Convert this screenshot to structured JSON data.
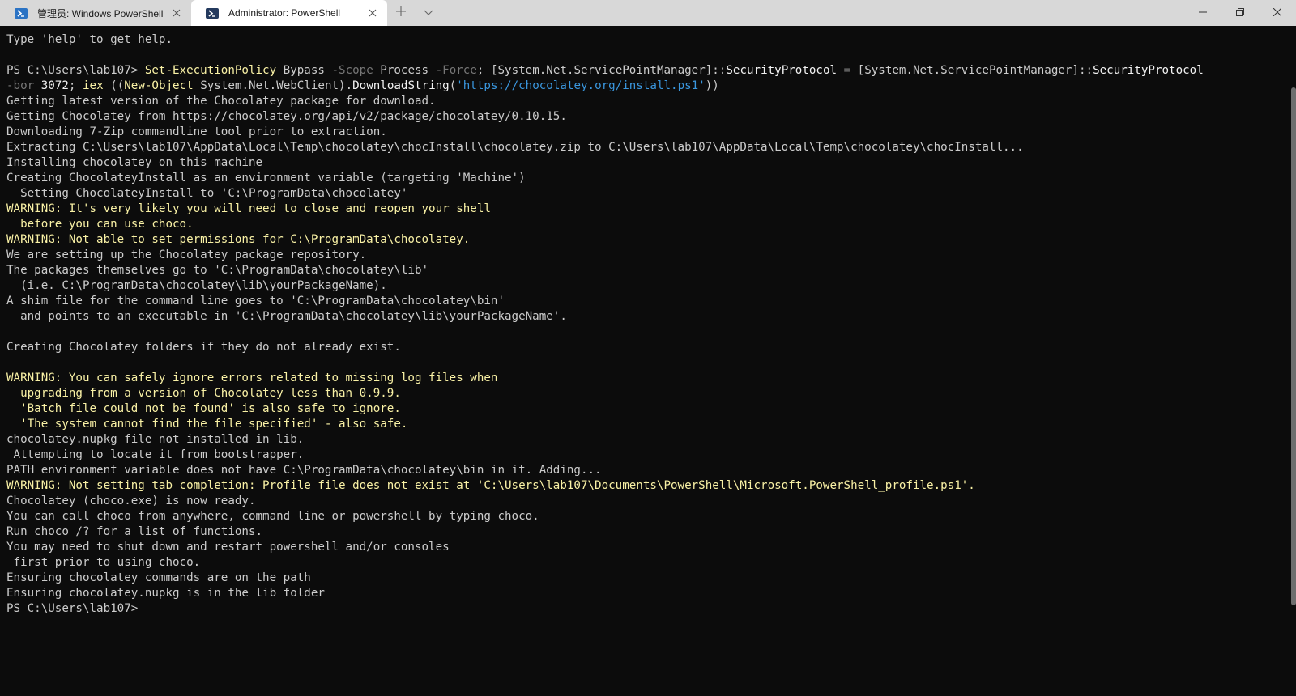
{
  "window": {
    "tabs": [
      {
        "title": "管理员: Windows PowerShell",
        "active": false,
        "icon": "powershell-icon"
      },
      {
        "title": "Administrator: PowerShell",
        "active": true,
        "icon": "powershell-core-icon"
      }
    ],
    "new_tab_icon": "plus-icon",
    "dropdown_icon": "chevron-down-icon",
    "controls": [
      "minimize-icon",
      "restore-icon",
      "close-icon"
    ]
  },
  "colors": {
    "terminal_bg": "#0c0c0c",
    "text": "#cccccc",
    "warning": "#f9f1a5",
    "cmdlet": "#f9f1a5",
    "parameter": "#767676",
    "string": "#3a96dd"
  },
  "terminal": {
    "lines": [
      {
        "type": "normal",
        "text": "Type 'help' to get help."
      },
      {
        "type": "blank",
        "text": ""
      },
      {
        "type": "command",
        "segments": [
          {
            "t": "prompt",
            "text": "PS C:\\Users\\lab107> "
          },
          {
            "t": "cmd",
            "text": "Set-ExecutionPolicy"
          },
          {
            "t": "plain",
            "text": " Bypass "
          },
          {
            "t": "param",
            "text": "-Scope"
          },
          {
            "t": "plain",
            "text": " Process "
          },
          {
            "t": "param",
            "text": "-Force"
          },
          {
            "t": "plain",
            "text": "; [System.Net.ServicePointManager]::"
          },
          {
            "t": "white",
            "text": "SecurityProtocol"
          },
          {
            "t": "param",
            "text": " = "
          },
          {
            "t": "plain",
            "text": "[System.Net.ServicePointManager]::"
          },
          {
            "t": "white",
            "text": "SecurityProtocol"
          }
        ]
      },
      {
        "type": "command",
        "segments": [
          {
            "t": "param",
            "text": "-bor"
          },
          {
            "t": "plain",
            "text": " "
          },
          {
            "t": "num",
            "text": "3072"
          },
          {
            "t": "plain",
            "text": "; "
          },
          {
            "t": "cmd",
            "text": "iex"
          },
          {
            "t": "plain",
            "text": " (("
          },
          {
            "t": "cmd",
            "text": "New-Object"
          },
          {
            "t": "plain",
            "text": " System.Net.WebClient)."
          },
          {
            "t": "white",
            "text": "DownloadString"
          },
          {
            "t": "plain",
            "text": "("
          },
          {
            "t": "str",
            "text": "'https://chocolatey.org/install.ps1'"
          },
          {
            "t": "plain",
            "text": "))"
          }
        ]
      },
      {
        "type": "normal",
        "text": "Getting latest version of the Chocolatey package for download."
      },
      {
        "type": "normal",
        "text": "Getting Chocolatey from https://chocolatey.org/api/v2/package/chocolatey/0.10.15."
      },
      {
        "type": "normal",
        "text": "Downloading 7-Zip commandline tool prior to extraction."
      },
      {
        "type": "normal",
        "text": "Extracting C:\\Users\\lab107\\AppData\\Local\\Temp\\chocolatey\\chocInstall\\chocolatey.zip to C:\\Users\\lab107\\AppData\\Local\\Temp\\chocolatey\\chocInstall..."
      },
      {
        "type": "normal",
        "text": "Installing chocolatey on this machine"
      },
      {
        "type": "normal",
        "text": "Creating ChocolateyInstall as an environment variable (targeting 'Machine')"
      },
      {
        "type": "normal",
        "text": "  Setting ChocolateyInstall to 'C:\\ProgramData\\chocolatey'"
      },
      {
        "type": "warn",
        "text": "WARNING: It's very likely you will need to close and reopen your shell"
      },
      {
        "type": "warn",
        "text": "  before you can use choco."
      },
      {
        "type": "warn",
        "text": "WARNING: Not able to set permissions for C:\\ProgramData\\chocolatey."
      },
      {
        "type": "normal",
        "text": "We are setting up the Chocolatey package repository."
      },
      {
        "type": "normal",
        "text": "The packages themselves go to 'C:\\ProgramData\\chocolatey\\lib'"
      },
      {
        "type": "normal",
        "text": "  (i.e. C:\\ProgramData\\chocolatey\\lib\\yourPackageName)."
      },
      {
        "type": "normal",
        "text": "A shim file for the command line goes to 'C:\\ProgramData\\chocolatey\\bin'"
      },
      {
        "type": "normal",
        "text": "  and points to an executable in 'C:\\ProgramData\\chocolatey\\lib\\yourPackageName'."
      },
      {
        "type": "blank",
        "text": ""
      },
      {
        "type": "normal",
        "text": "Creating Chocolatey folders if they do not already exist."
      },
      {
        "type": "blank",
        "text": ""
      },
      {
        "type": "warn",
        "text": "WARNING: You can safely ignore errors related to missing log files when"
      },
      {
        "type": "warn",
        "text": "  upgrading from a version of Chocolatey less than 0.9.9."
      },
      {
        "type": "warn",
        "text": "  'Batch file could not be found' is also safe to ignore."
      },
      {
        "type": "warn",
        "text": "  'The system cannot find the file specified' - also safe."
      },
      {
        "type": "normal",
        "text": "chocolatey.nupkg file not installed in lib."
      },
      {
        "type": "normal",
        "text": " Attempting to locate it from bootstrapper."
      },
      {
        "type": "normal",
        "text": "PATH environment variable does not have C:\\ProgramData\\chocolatey\\bin in it. Adding..."
      },
      {
        "type": "warn",
        "text": "WARNING: Not setting tab completion: Profile file does not exist at 'C:\\Users\\lab107\\Documents\\PowerShell\\Microsoft.PowerShell_profile.ps1'."
      },
      {
        "type": "normal",
        "text": "Chocolatey (choco.exe) is now ready."
      },
      {
        "type": "normal",
        "text": "You can call choco from anywhere, command line or powershell by typing choco."
      },
      {
        "type": "normal",
        "text": "Run choco /? for a list of functions."
      },
      {
        "type": "normal",
        "text": "You may need to shut down and restart powershell and/or consoles"
      },
      {
        "type": "normal",
        "text": " first prior to using choco."
      },
      {
        "type": "normal",
        "text": "Ensuring chocolatey commands are on the path"
      },
      {
        "type": "normal",
        "text": "Ensuring chocolatey.nupkg is in the lib folder"
      },
      {
        "type": "prompt",
        "text": "PS C:\\Users\\lab107> "
      }
    ]
  }
}
